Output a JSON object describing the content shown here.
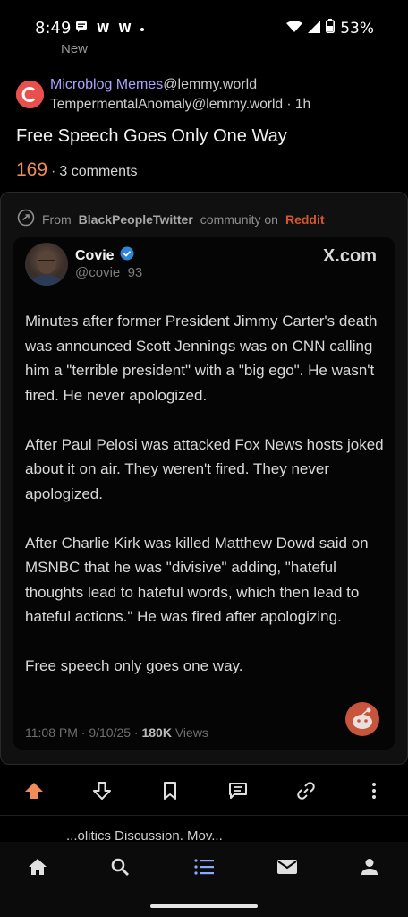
{
  "status_bar": {
    "time": "8:49",
    "battery": "53%",
    "left_icons": [
      "chat-icon",
      "w-icon",
      "w-icon-2",
      "dot"
    ],
    "right_icons": [
      "wifi-icon",
      "signal-icon",
      "battery-icon"
    ]
  },
  "prev_item": {
    "text": "New"
  },
  "post": {
    "community": "Microblog Memes",
    "community_instance": "@lemmy.world",
    "author": "TempermentalAnomaly@lemmy.world",
    "separator": " · ",
    "age": "1h",
    "title": "Free Speech Goes Only One Way",
    "score": "169",
    "dot": "·",
    "comments": "3 comments",
    "accent_color": "#f08b5a",
    "community_color": "#a8a4ff"
  },
  "embed": {
    "prefix": "From",
    "source_community": "BlackPeopleTwitter",
    "middle": "community on",
    "platform": "Reddit",
    "tweet": {
      "name": "Covie",
      "handle": "@covie_93",
      "brand": "X.com",
      "paragraphs": [
        "Minutes after former President Jimmy Carter's death was announced Scott Jennings was on CNN calling him a \"terrible president\" with a \"big ego\". He wasn't fired. He never apologized.",
        "After Paul Pelosi was attacked Fox News hosts joked about it on air. They weren't fired. They never apologized.",
        "After Charlie Kirk was killed Matthew Dowd said on MSNBC that he was \"divisive\" adding, \"hateful thoughts lead to hateful words, which then lead to hateful actions.\" He was fired after apologizing.",
        "Free speech only goes one way."
      ],
      "time": "11:08 PM · 9/10/25 · ",
      "views_count": "180K",
      "views_label": " Views"
    }
  },
  "actions": [
    "upvote-icon",
    "downvote-icon",
    "bookmark-icon",
    "comment-icon",
    "link-icon",
    "more-icon"
  ],
  "next_item": {
    "text": "...olitics Discussion, Mov..."
  },
  "nav": [
    "home-icon",
    "search-icon",
    "feed-icon",
    "inbox-icon",
    "profile-icon"
  ],
  "nav_active_color": "#8fa8ff"
}
